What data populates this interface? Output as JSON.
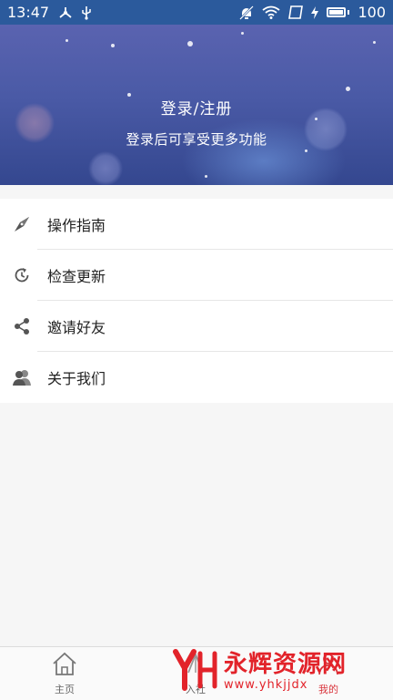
{
  "status_bar": {
    "time": "13:47",
    "battery": "100",
    "icons": [
      "fork-icon",
      "usb-icon",
      "do-not-disturb-icon",
      "wifi-icon",
      "sim-icon",
      "charging-icon",
      "battery-icon"
    ]
  },
  "header": {
    "title": "登录/注册",
    "subtitle": "登录后可享受更多功能"
  },
  "menu": {
    "items": [
      {
        "label": "操作指南",
        "icon": "compass-icon"
      },
      {
        "label": "检查更新",
        "icon": "refresh-clock-icon"
      },
      {
        "label": "邀请好友",
        "icon": "share-icon"
      },
      {
        "label": "关于我们",
        "icon": "users-icon"
      }
    ]
  },
  "bottom_nav": {
    "items": [
      {
        "label": "主页",
        "icon": "home-icon"
      },
      {
        "label": "入社",
        "icon": "join-icon"
      },
      {
        "label": "我的",
        "icon": "profile-icon",
        "active": true
      }
    ],
    "active_color": "#d9363e"
  },
  "watermark": {
    "name": "永辉资源网",
    "url": "www.yhkjjdx",
    "color": "#e2232a"
  },
  "colors": {
    "status_bar": "#2b5a9c",
    "banner": "#4a5aa6"
  }
}
